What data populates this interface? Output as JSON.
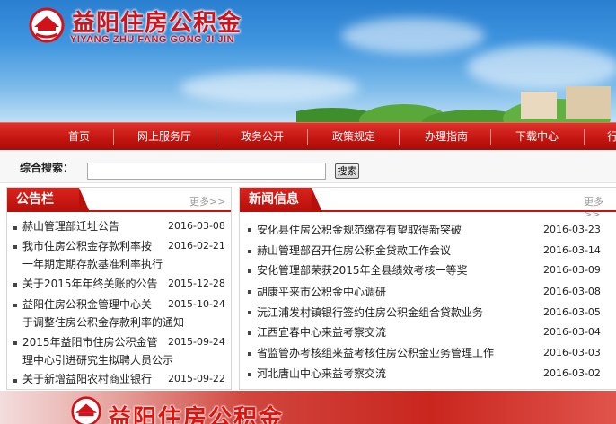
{
  "header": {
    "title": "益阳住房公积金",
    "pinyin": "YIYANG ZHU FANG GONG JI JIN",
    "logo_icon": "yiyang-hpf-logo-icon",
    "brand_color": "#d0121b"
  },
  "nav": {
    "items": [
      {
        "label": "首页"
      },
      {
        "label": "网上服务厅"
      },
      {
        "label": "政务公开"
      },
      {
        "label": "政策规定"
      },
      {
        "label": "办理指南"
      },
      {
        "label": "下载中心"
      },
      {
        "label": "行"
      }
    ]
  },
  "search": {
    "label": "综合搜索：",
    "value": "",
    "button_label": "搜索"
  },
  "announcements": {
    "title": "公告栏",
    "more_label": "更多>>",
    "items": [
      {
        "lines": [
          "赫山管理部迁址公告"
        ],
        "date": "2016-03-08"
      },
      {
        "lines": [
          "我市住房公积金存款利率按",
          "一年期定期存款基准利率执行"
        ],
        "date": "2016-02-21"
      },
      {
        "lines": [
          "关于2015年年终关账的公告"
        ],
        "date": "2015-12-28"
      },
      {
        "lines": [
          "益阳住房公积金管理中心关",
          "于调整住房公积金存款利率的通知"
        ],
        "date": "2015-10-24"
      },
      {
        "lines": [
          "2015年益阳市住房公积金管",
          "理中心引进研究生拟聘人员公示"
        ],
        "date": "2015-09-24"
      },
      {
        "lines": [
          "关于新增益阳农村商业银行"
        ],
        "date": "2015-09-22"
      }
    ]
  },
  "news": {
    "title": "新闻信息",
    "more_label": "更多>>",
    "items": [
      {
        "text": "安化县住房公积金规范缴存有望取得新突破",
        "date": "2016-03-23"
      },
      {
        "text": "赫山管理部召开住房公积金贷款工作会议",
        "date": "2016-03-14"
      },
      {
        "text": "安化管理部荣获2015年全县绩效考核一等奖",
        "date": "2016-03-09"
      },
      {
        "text": "胡康平来市公积金中心调研",
        "date": "2016-03-08"
      },
      {
        "text": "沅江浦发村镇银行签约住房公积金组合贷款业务",
        "date": "2016-03-05"
      },
      {
        "text": "江西宜春中心来益考察交流",
        "date": "2016-03-04"
      },
      {
        "text": "省监管办考核组来益考核住房公积金业务管理工作",
        "date": "2016-03-03"
      },
      {
        "text": "河北唐山中心来益考察交流",
        "date": "2016-03-02"
      }
    ]
  },
  "footer": {
    "title": "益阳住房公积金"
  }
}
